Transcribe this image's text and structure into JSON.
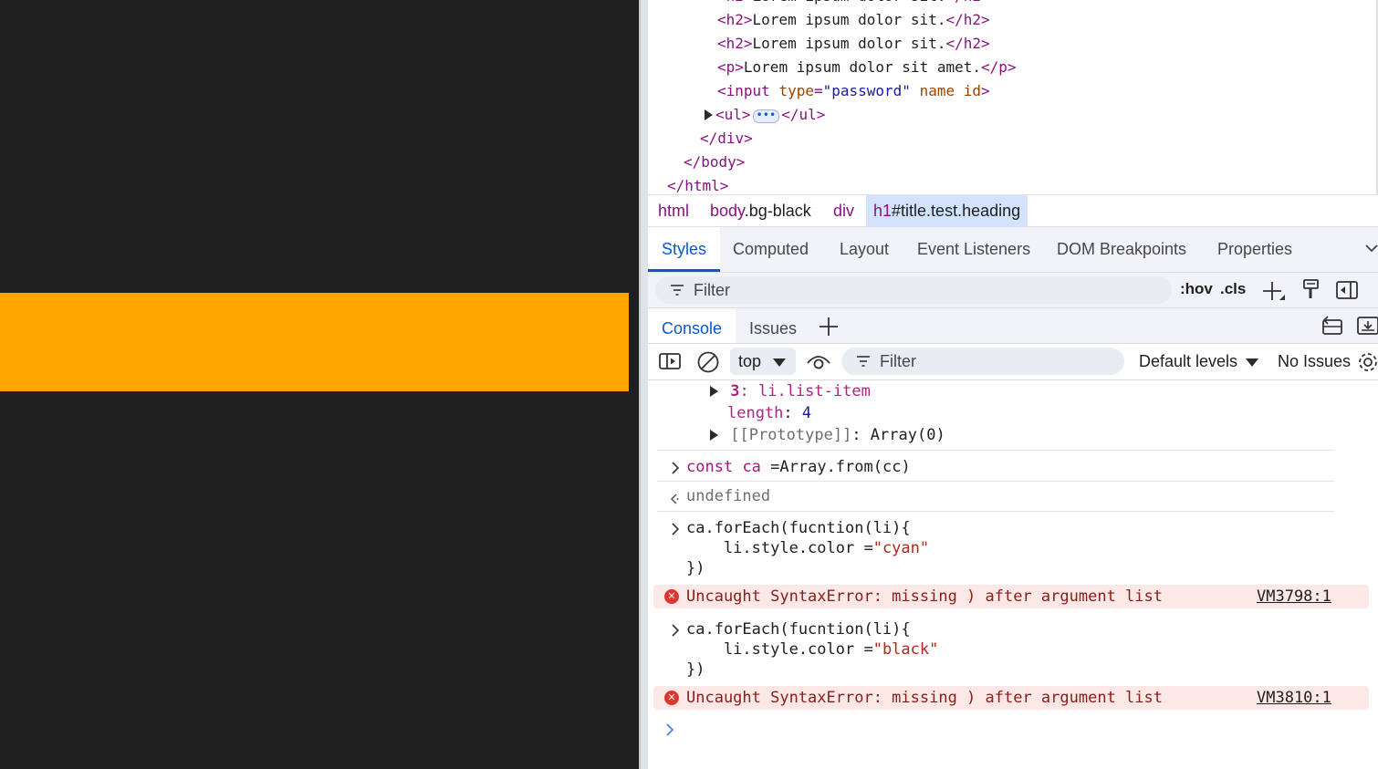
{
  "colors": {
    "page_background": "#202020",
    "orange_bar": "#ffa500",
    "accent": "#0b57d0",
    "error_background": "#fce8e6"
  },
  "elements_tree": {
    "lines": [
      {
        "indent": 4,
        "open": "<h2>",
        "text": "Lorem ipsum dolor sit.",
        "close": "</h2>"
      },
      {
        "indent": 4,
        "open": "<h2>",
        "text": "Lorem ipsum dolor sit.",
        "close": "</h2>"
      },
      {
        "indent": 4,
        "open": "<p>",
        "text": "Lorem ipsum dolor sit amet.",
        "close": "</p>"
      }
    ],
    "input_line": {
      "tag_open": "<input",
      "attr1": "type",
      "val1": "\"password\"",
      "attr2": "name",
      "attr3": "id",
      "tag_end": ">"
    },
    "ul_line": {
      "open": "<ul>",
      "dots": "•••",
      "close": "</ul>"
    },
    "closing_div": "</div>",
    "closing_body": "</body>",
    "closing_html": "</html>"
  },
  "breadcrumb": {
    "items": [
      {
        "tag": "html",
        "rest": ""
      },
      {
        "tag": "body",
        "rest": ".bg-black"
      },
      {
        "tag": "div",
        "rest": ""
      },
      {
        "tag": "h1",
        "rest": "#title.test.heading"
      }
    ]
  },
  "styles_tabs": [
    "Styles",
    "Computed",
    "Layout",
    "Event Listeners",
    "DOM Breakpoints",
    "Properties"
  ],
  "styles_filter": {
    "placeholder": "Filter",
    "hov": ":hov",
    "cls": ".cls"
  },
  "drawer_tabs": [
    "Console",
    "Issues"
  ],
  "console_toolbar": {
    "context": "top",
    "filter_placeholder": "Filter",
    "levels": "Default levels",
    "issues": "No Issues"
  },
  "console": {
    "array_item": {
      "index": "3",
      "value": "li.list-item"
    },
    "length": {
      "key": "length",
      "value": "4"
    },
    "prototype": {
      "key": "[[Prototype]]",
      "value": "Array(0)"
    },
    "cmd1": {
      "kw": "const",
      "var": "ca",
      "rest": " =Array.from(cc)"
    },
    "result1": "undefined",
    "cmd2": {
      "line1": "ca.forEach(fucntion(li){",
      "line2_pre": "    li.style.color =",
      "line2_str": "\"cyan\"",
      "line3": "})"
    },
    "error1": {
      "message": "Uncaught SyntaxError: missing ) after argument list",
      "source": "VM3798:1"
    },
    "cmd3": {
      "line1": "ca.forEach(fucntion(li){",
      "line2_pre": "    li.style.color =",
      "line2_str": "\"black\"",
      "line3": "})"
    },
    "error2": {
      "message": "Uncaught SyntaxError: missing ) after argument list",
      "source": "VM3810:1"
    }
  }
}
